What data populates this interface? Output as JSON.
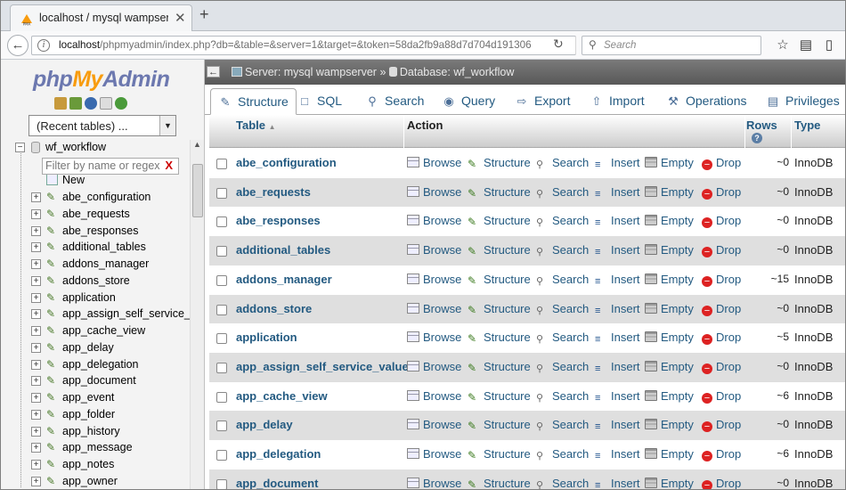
{
  "browser": {
    "tab_title": "localhost / mysql wampser...",
    "tab_close": "✕",
    "new_tab": "+",
    "url_host": "localhost",
    "url_path": "/phpmyadmin/index.php?db=&table=&server=1&target=&token=58da2fb9a88d7d704d191306",
    "search_placeholder": "Search"
  },
  "sidebar": {
    "logo_php": "php",
    "logo_my": "My",
    "logo_admin": "Admin",
    "recent_tables": "(Recent tables) ...",
    "database": "wf_workflow",
    "filter_placeholder": "Filter by name or regex",
    "filter_clear": "X",
    "new_label": "New",
    "tables": [
      "abe_configuration",
      "abe_requests",
      "abe_responses",
      "additional_tables",
      "addons_manager",
      "addons_store",
      "application",
      "app_assign_self_service_v",
      "app_cache_view",
      "app_delay",
      "app_delegation",
      "app_document",
      "app_event",
      "app_folder",
      "app_history",
      "app_message",
      "app_notes",
      "app_owner"
    ]
  },
  "breadcrumb": {
    "server": "Server: mysql wampserver",
    "separator": "»",
    "database": "Database: wf_workflow"
  },
  "tabs": [
    "Structure",
    "SQL",
    "Search",
    "Query",
    "Export",
    "Import",
    "Operations",
    "Privileges"
  ],
  "table_header": {
    "table": "Table",
    "sort_arrow": "▲",
    "action": "Action",
    "rows": "Rows",
    "type": "Type"
  },
  "actions": {
    "browse": "Browse",
    "structure": "Structure",
    "search": "Search",
    "insert": "Insert",
    "empty": "Empty",
    "drop": "Drop"
  },
  "rows": [
    {
      "name": "abe_configuration",
      "rows": "~0",
      "type": "InnoDB"
    },
    {
      "name": "abe_requests",
      "rows": "~0",
      "type": "InnoDB"
    },
    {
      "name": "abe_responses",
      "rows": "~0",
      "type": "InnoDB"
    },
    {
      "name": "additional_tables",
      "rows": "~0",
      "type": "InnoDB"
    },
    {
      "name": "addons_manager",
      "rows": "~15",
      "type": "InnoDB"
    },
    {
      "name": "addons_store",
      "rows": "~0",
      "type": "InnoDB"
    },
    {
      "name": "application",
      "rows": "~5",
      "type": "InnoDB"
    },
    {
      "name": "app_assign_self_service_value",
      "rows": "~0",
      "type": "InnoDB"
    },
    {
      "name": "app_cache_view",
      "rows": "~6",
      "type": "InnoDB"
    },
    {
      "name": "app_delay",
      "rows": "~0",
      "type": "InnoDB"
    },
    {
      "name": "app_delegation",
      "rows": "~6",
      "type": "InnoDB"
    },
    {
      "name": "app_document",
      "rows": "~0",
      "type": "InnoDB"
    }
  ]
}
